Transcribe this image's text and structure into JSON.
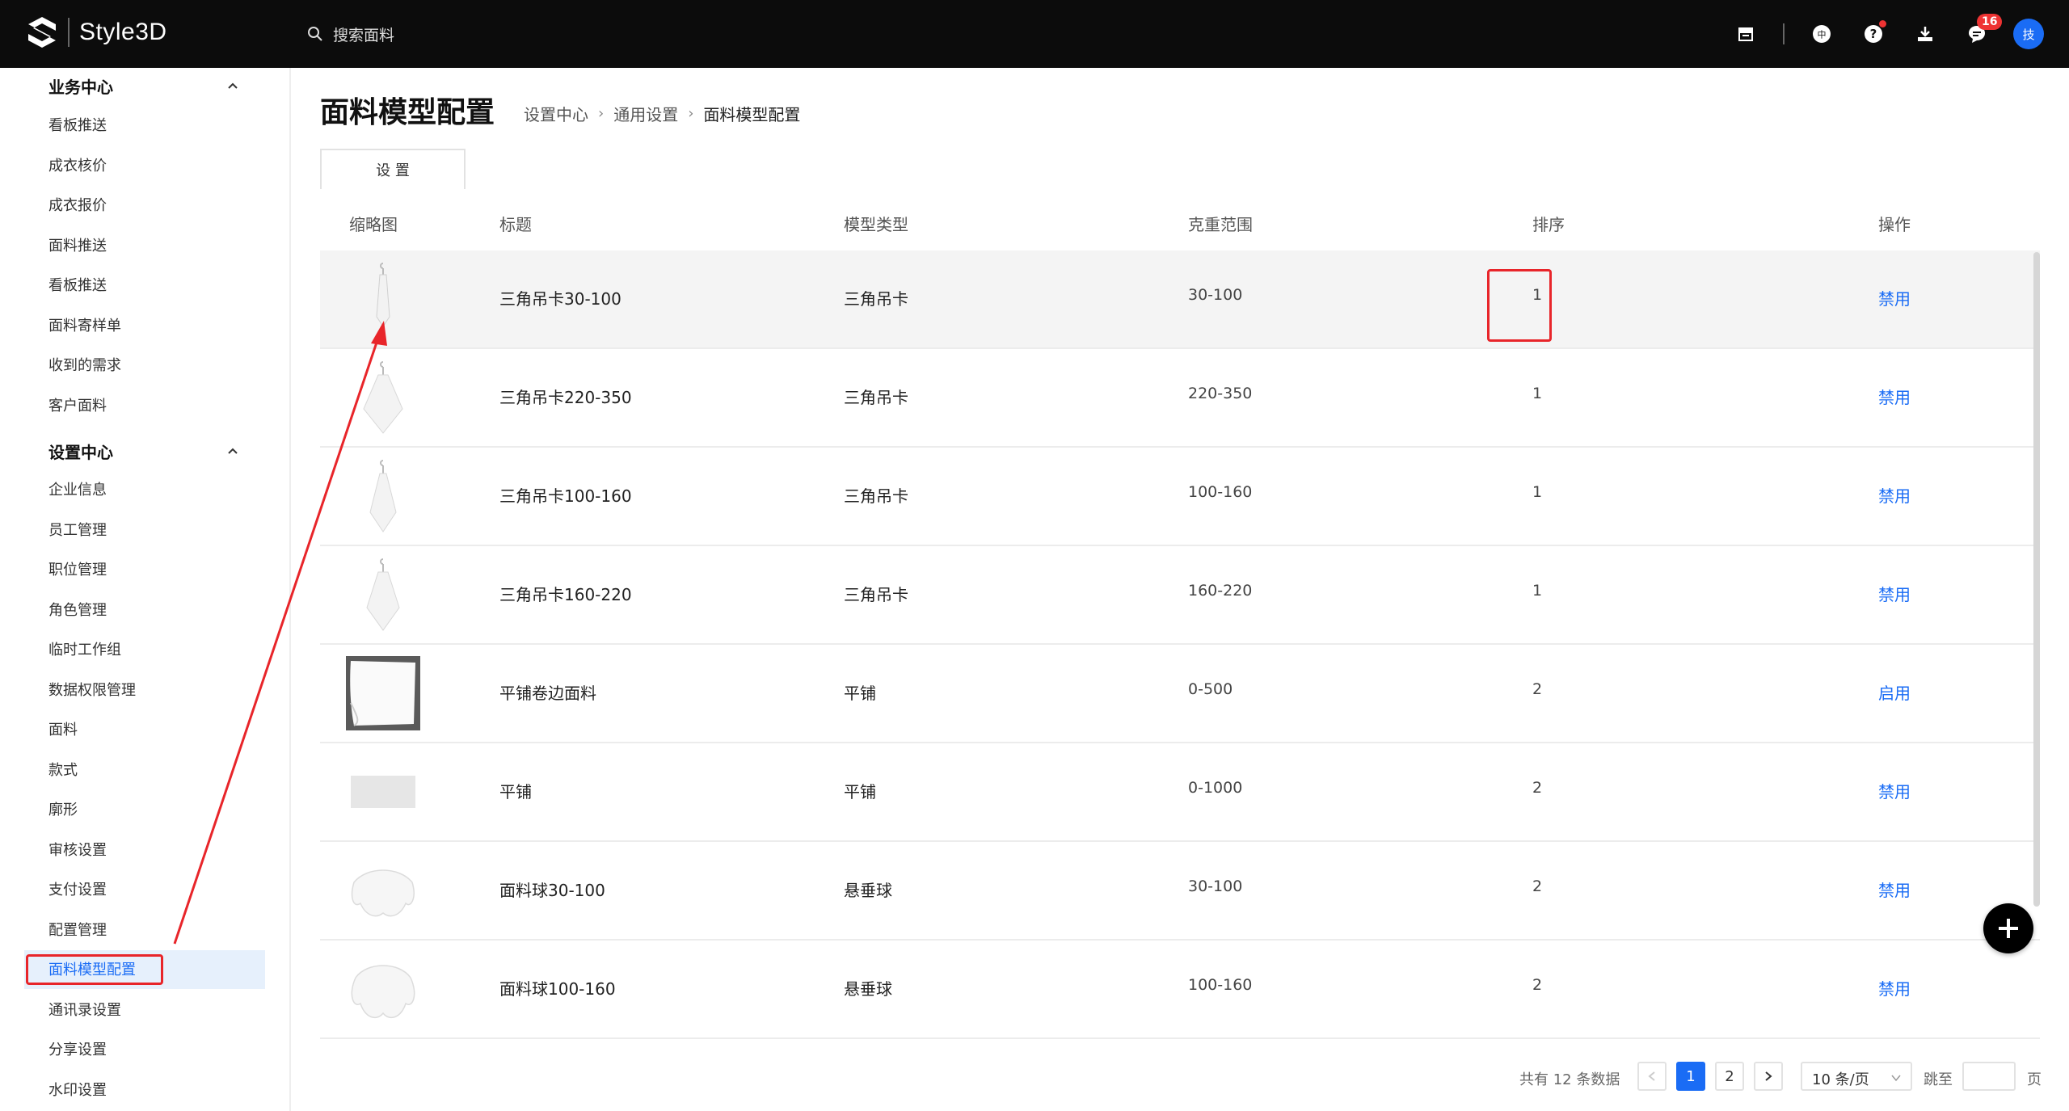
{
  "app": {
    "logo_text": "Style3D"
  },
  "search": {
    "placeholder": "搜索面料"
  },
  "header": {
    "notification_count": "16",
    "avatar_text": "技"
  },
  "sidebar": {
    "groups": [
      {
        "title": "业务中心",
        "items": [
          "看板推送",
          "成衣核价",
          "成衣报价",
          "面料推送",
          "看板推送",
          "面料寄样单",
          "收到的需求",
          "客户面料"
        ]
      },
      {
        "title": "设置中心",
        "items": [
          "企业信息",
          "员工管理",
          "职位管理",
          "角色管理",
          "临时工作组",
          "数据权限管理",
          "面料",
          "款式",
          "廓形",
          "审核设置",
          "支付设置",
          "配置管理",
          "面料模型配置",
          "通讯录设置",
          "分享设置",
          "水印设置"
        ]
      }
    ],
    "active_item": "面料模型配置"
  },
  "page": {
    "title": "面料模型配置",
    "breadcrumb": [
      "设置中心",
      "通用设置",
      "面料模型配置"
    ],
    "tab_label": "设 置"
  },
  "table": {
    "headers": [
      "缩略图",
      "标题",
      "模型类型",
      "克重范围",
      "排序",
      "操作"
    ],
    "rows": [
      {
        "thumb": "hanger-card",
        "title": "三角吊卡30-100",
        "type": "三角吊卡",
        "range": "30-100",
        "order": "1",
        "action": "禁用"
      },
      {
        "thumb": "hanger-card",
        "title": "三角吊卡220-350",
        "type": "三角吊卡",
        "range": "220-350",
        "order": "1",
        "action": "禁用"
      },
      {
        "thumb": "hanger-card",
        "title": "三角吊卡100-160",
        "type": "三角吊卡",
        "range": "100-160",
        "order": "1",
        "action": "禁用"
      },
      {
        "thumb": "hanger-card",
        "title": "三角吊卡160-220",
        "type": "三角吊卡",
        "range": "160-220",
        "order": "1",
        "action": "禁用"
      },
      {
        "thumb": "flat-curl",
        "title": "平铺卷边面料",
        "type": "平铺",
        "range": "0-500",
        "order": "2",
        "action": "启用"
      },
      {
        "thumb": "flat",
        "title": "平铺",
        "type": "平铺",
        "range": "0-1000",
        "order": "2",
        "action": "禁用"
      },
      {
        "thumb": "drape-ball",
        "title": "面料球30-100",
        "type": "悬垂球",
        "range": "30-100",
        "order": "2",
        "action": "禁用"
      },
      {
        "thumb": "drape-ball",
        "title": "面料球100-160",
        "type": "悬垂球",
        "range": "100-160",
        "order": "2",
        "action": "禁用"
      }
    ]
  },
  "pagination": {
    "total_text": "共有 12 条数据",
    "pages": [
      "1",
      "2"
    ],
    "current_page": "1",
    "page_size": "10 条/页",
    "jump_label": "跳至",
    "page_unit": "页"
  },
  "colors": {
    "accent": "#1a6cf5",
    "annotation": "#e8252a",
    "topbar": "#0c0c0c"
  }
}
